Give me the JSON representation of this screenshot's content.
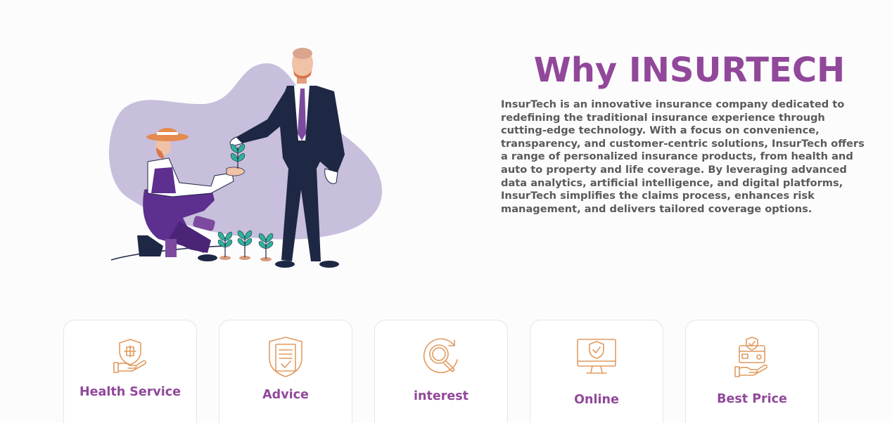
{
  "why": {
    "title": "Why INSURTECH",
    "description": "InsurTech is an innovative insurance company dedicated to redefining the traditional insurance experience through cutting-edge technology. With a focus on convenience, transparency, and customer-centric solutions, InsurTech offers a range of personalized insurance products, from health and auto to property and life coverage. By leveraging advanced data analytics, artificial intelligence, and digital platforms, InsurTech simplifies the claims process, enhances risk management, and delivers tailored coverage options."
  },
  "features": [
    {
      "label": "Health Service",
      "icon": "health-shield-hand-icon"
    },
    {
      "label": "Advice",
      "icon": "document-shield-check-icon"
    },
    {
      "label": "interest",
      "icon": "magnifier-refresh-icon"
    },
    {
      "label": "Online",
      "icon": "monitor-shield-check-icon"
    },
    {
      "label": "Best Price",
      "icon": "card-hand-shield-icon"
    }
  ],
  "colors": {
    "accent": "#91489a",
    "icon_stroke": "#e29a5f",
    "blob": "#c7bfdc",
    "suit": "#1e2744"
  }
}
